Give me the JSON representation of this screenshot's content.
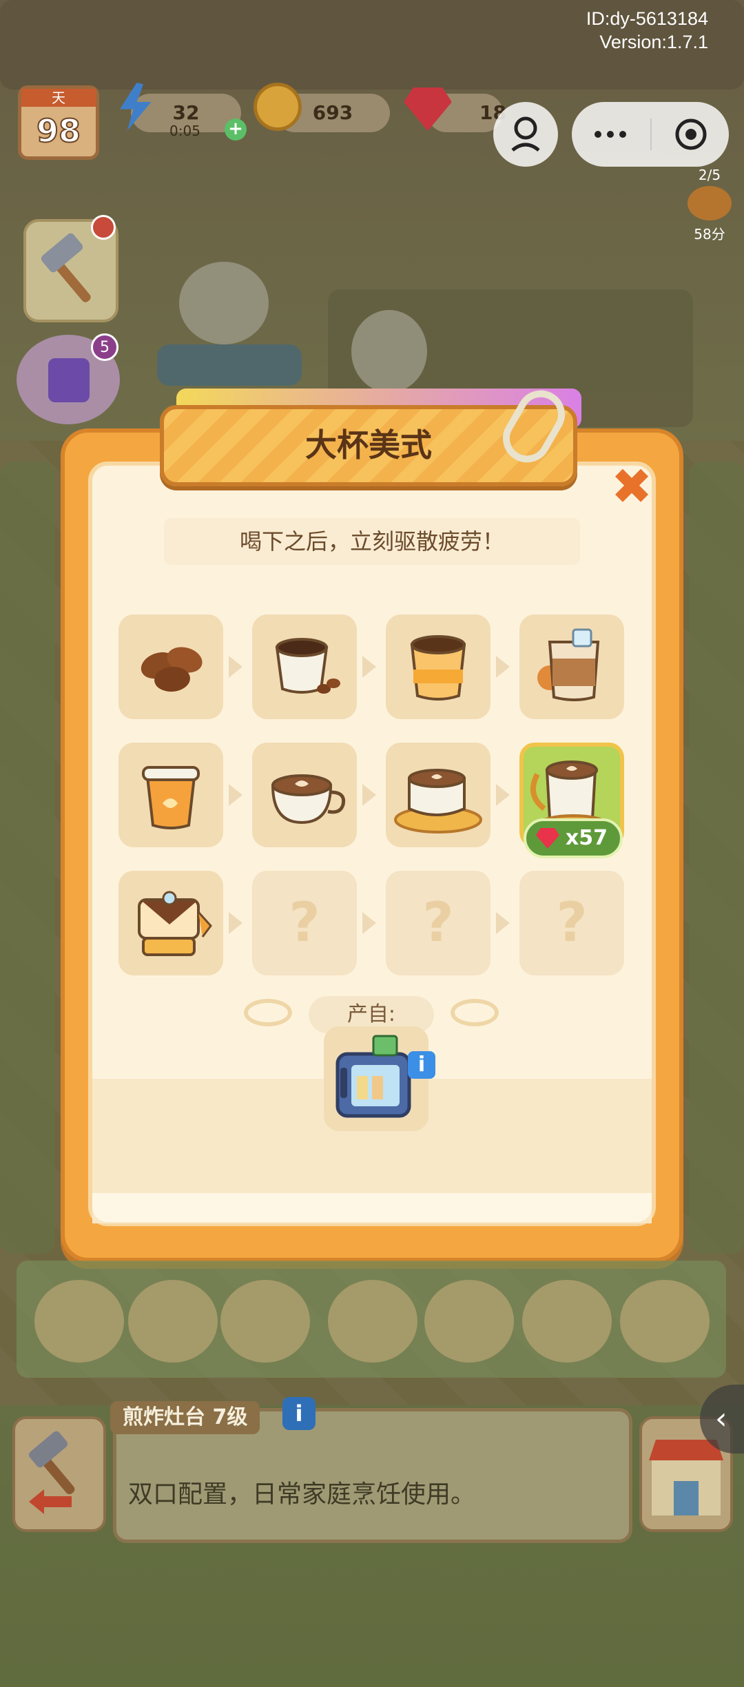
{
  "app": {
    "id_label": "ID:dy-5613184",
    "version_label": "Version:1.7.1"
  },
  "hud": {
    "day_label": "天",
    "day_value": "98",
    "energy": "32",
    "energy_timer": "0:05",
    "coins": "693",
    "gems": "18",
    "rank_progress": "2/5",
    "rank_points": "58分",
    "gift_count": "5"
  },
  "modal": {
    "title": "大杯美式",
    "description": "喝下之后，立刻驱散疲劳！",
    "close_icon": "close-x-icon",
    "chain": [
      {
        "icon": "coffee-beans-icon",
        "locked": false
      },
      {
        "icon": "espresso-cup-icon",
        "locked": false
      },
      {
        "icon": "paper-cup-coffee-icon",
        "locked": false
      },
      {
        "icon": "iced-coffee-icon",
        "locked": false
      },
      {
        "icon": "takeaway-coffee-icon",
        "locked": false
      },
      {
        "icon": "latte-art-cup-icon",
        "locked": false
      },
      {
        "icon": "cappuccino-saucer-icon",
        "locked": false
      },
      {
        "icon": "large-americano-icon",
        "locked": false,
        "current": true
      },
      {
        "icon": "coffee-maker-icon",
        "locked": false
      },
      {
        "icon": "unknown-item-icon",
        "locked": true,
        "text": "?"
      },
      {
        "icon": "unknown-item-icon",
        "locked": true,
        "text": "?"
      },
      {
        "icon": "unknown-item-icon",
        "locked": true,
        "text": "?"
      }
    ],
    "current_price": "x57",
    "source_label": "产自:",
    "source_icon": "vending-machine-icon",
    "source_info": "i"
  },
  "bottom_panel": {
    "title": "煎炸灶台 7级",
    "info": "i",
    "description": "双口配置，日常家庭烹饪使用。",
    "side_arrow": "‹"
  },
  "colors": {
    "modal_orange": "#f4a640",
    "panel_cream": "#fdf3dd",
    "title_text": "#5a3417",
    "highlight_green": "#b4d45a",
    "gem_red": "#e8334a"
  }
}
